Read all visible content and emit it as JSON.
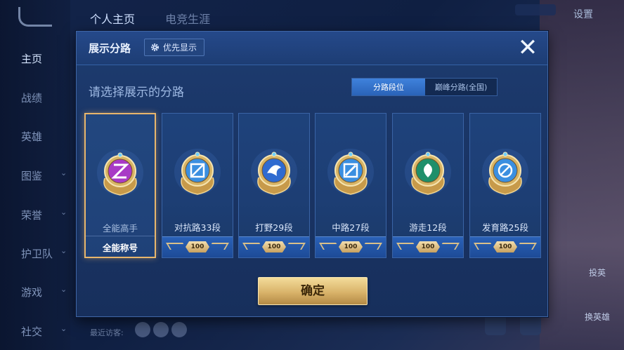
{
  "background": {
    "nav_items": [
      {
        "label": "主页",
        "active": true
      },
      {
        "label": "战绩"
      },
      {
        "label": "英雄"
      },
      {
        "label": "图鉴"
      },
      {
        "label": "荣誉"
      },
      {
        "label": "护卫队"
      },
      {
        "label": "游戏"
      },
      {
        "label": "社交"
      }
    ],
    "top_tabs": [
      "个人主页",
      "电竞生涯"
    ],
    "settings_label": "设置",
    "visitor_label": "最近访客:",
    "right_buttons": [
      "投英",
      "换英雄"
    ]
  },
  "dialog": {
    "title": "展示分路",
    "priority_label": "优先显示",
    "close_label": "✕",
    "subtitle": "请选择展示的分路",
    "segment": {
      "options": [
        "分路段位",
        "巅峰分路(全国)"
      ],
      "selected": "分路段位"
    },
    "cards": [
      {
        "label": "全能高手",
        "footer": "全能称号",
        "selected": true,
        "emblem": "all-round-emblem-icon",
        "color": "#a83ac6"
      },
      {
        "label": "对抗路33段",
        "plaque": "100",
        "emblem": "clash-lane-emblem-icon",
        "color": "#3b8fe0"
      },
      {
        "label": "打野29段",
        "plaque": "100",
        "emblem": "jungle-emblem-icon",
        "color": "#2f6bd0"
      },
      {
        "label": "中路27段",
        "plaque": "100",
        "emblem": "mid-lane-emblem-icon",
        "color": "#3b8fe0"
      },
      {
        "label": "游走12段",
        "plaque": "100",
        "emblem": "roam-emblem-icon",
        "color": "#1f8f6a"
      },
      {
        "label": "发育路25段",
        "plaque": "100",
        "emblem": "farm-lane-emblem-icon",
        "color": "#3b8fe0"
      }
    ],
    "confirm_label": "确定"
  },
  "colors": {
    "accent_gold": "#e8b66c",
    "selected_tab": "#3f82dc"
  }
}
